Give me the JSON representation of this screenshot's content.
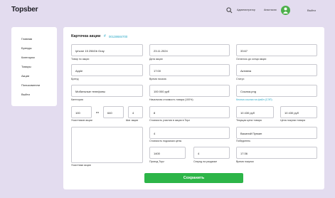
{
  "header": {
    "logo": "Topsber",
    "admin_label": "Администратор",
    "user_name": "Анастасия",
    "logout": "Выйти"
  },
  "sidebar": {
    "items": [
      {
        "label": "Главная"
      },
      {
        "label": "Бренды"
      },
      {
        "label": "Категории"
      },
      {
        "label": "Товары"
      },
      {
        "label": "Акции"
      },
      {
        "label": "Пользователи"
      },
      {
        "label": "Выйти"
      }
    ]
  },
  "card": {
    "title": "Карточка акции",
    "id_icon": "#",
    "id": "00138684700"
  },
  "fields": {
    "product": {
      "value": "Iphone 15 256Gb Gray",
      "label": "Товар по акции"
    },
    "date": {
      "value": "23.11.2024",
      "label": "Дата акции"
    },
    "remaining": {
      "value": "33:67",
      "label": "Осталось до конца акции"
    },
    "brand": {
      "value": "Apple",
      "label": "Бренд"
    },
    "start_time": {
      "value": "17:00",
      "label": "Время начала"
    },
    "status": {
      "value": "Активна",
      "label": "Статус"
    },
    "category": {
      "value": "Мобильные телефоны",
      "label": "Категория"
    },
    "start_price": {
      "value": "100 000 руб",
      "label": "Начальная стоимость товара (100%)"
    },
    "icon_link": {
      "value": "Ссылка.png",
      "label": "Кнопка ссылки на файл (СЭП)"
    },
    "scale_a": {
      "value": "100"
    },
    "scale_sep": "из",
    "scale_b": {
      "value": "640"
    },
    "scale_c": {
      "value": "4"
    },
    "scale_label": "Участников акции",
    "step_label": "Шаг акции",
    "participation_cost": {
      "value": "8",
      "label": "Стоимость участия в акции в Topz"
    },
    "current_price": {
      "value": "10 430 руб",
      "label": "Текущая цена товара"
    },
    "buy_price": {
      "value": "10 430 руб",
      "label": "Цена покупки товара"
    },
    "hint_cost": {
      "value": "4",
      "label": "Стоимость подсказки цены"
    },
    "winner": {
      "value": "Василий Пупкин",
      "label": "Победитель"
    },
    "description": {
      "value": "",
      "label": "Участники акции"
    },
    "topz_income": {
      "value": "1400",
      "label": "Приход Topz"
    },
    "seconds_round": {
      "value": "4",
      "label": "Секунд на раздачке"
    },
    "buy_time": {
      "value": "17:36",
      "label": "Время покупки"
    }
  },
  "actions": {
    "save": "Сохранить"
  },
  "colors": {
    "background": "#e3dcef",
    "accent": "#2db548",
    "link": "#2aa8c6"
  }
}
